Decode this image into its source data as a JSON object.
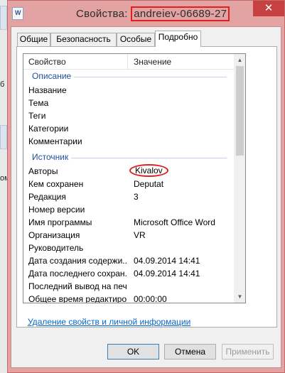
{
  "window": {
    "title_prefix": "Свойства: ",
    "title_name": "andreiev-06689-27",
    "close_glyph": "✕"
  },
  "background": {
    "fragments": [
      "б",
      "ом"
    ]
  },
  "tabs": [
    {
      "label": "Общие"
    },
    {
      "label": "Безопасность"
    },
    {
      "label": "Особые"
    },
    {
      "label": "Подробно",
      "active": true
    }
  ],
  "table": {
    "headers": {
      "property": "Свойство",
      "value": "Значение"
    },
    "groups": {
      "description": "Описание",
      "source": "Источник"
    },
    "rows": [
      {
        "property": "Название",
        "value": ""
      },
      {
        "property": "Тема",
        "value": ""
      },
      {
        "property": "Теги",
        "value": ""
      },
      {
        "property": "Категории",
        "value": ""
      },
      {
        "property": "Комментарии",
        "value": ""
      },
      {
        "property": "Авторы",
        "value": "Kivalov"
      },
      {
        "property": "Кем сохранен",
        "value": "Deputat"
      },
      {
        "property": "Редакция",
        "value": "3"
      },
      {
        "property": "Номер версии",
        "value": ""
      },
      {
        "property": "Имя программы",
        "value": "Microsoft Office Word"
      },
      {
        "property": "Организация",
        "value": "VR"
      },
      {
        "property": "Руководитель",
        "value": ""
      },
      {
        "property": "Дата создания содержи...",
        "value": "04.09.2014 14:41"
      },
      {
        "property": "Дата последнего сохран...",
        "value": "04.09.2014 14:41"
      },
      {
        "property": "Последний вывод на печ...",
        "value": ""
      },
      {
        "property": "Общее время редактиро...",
        "value": "00:00:00"
      }
    ]
  },
  "link": {
    "label": "Удаление свойств и личной информации"
  },
  "buttons": {
    "ok": "OK",
    "cancel": "Отмена",
    "apply": "Применить"
  },
  "colors": {
    "title_bar": "#e3a3a3",
    "close_button": "#c84141",
    "annotation_red": "#e02020",
    "group_label": "#1e4e9a",
    "link": "#0066cc"
  }
}
